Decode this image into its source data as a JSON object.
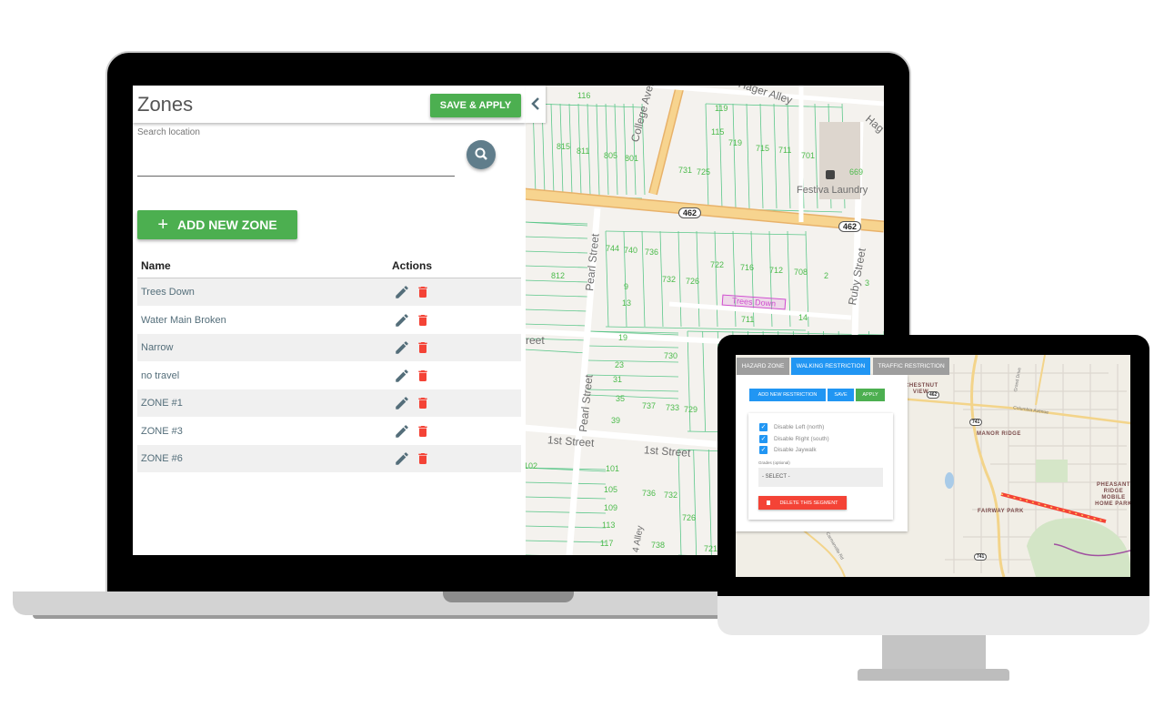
{
  "laptop": {
    "panel": {
      "title": "Zones",
      "save_apply_label": "SAVE & APPLY",
      "search": {
        "label": "Search location",
        "value": ""
      },
      "add_zone_label": "ADD NEW ZONE",
      "table": {
        "headers": [
          "Name",
          "Actions"
        ],
        "rows": [
          {
            "name": "Trees Down"
          },
          {
            "name": "Water Main Broken"
          },
          {
            "name": "Narrow"
          },
          {
            "name": "no travel"
          },
          {
            "name": "ZONE #1"
          },
          {
            "name": "ZONE #3"
          },
          {
            "name": "ZONE #6"
          }
        ]
      }
    },
    "map": {
      "streets": [
        "College Avenue",
        "Pearl Street",
        "Ruby Street",
        "1st Street",
        "Hager Alley",
        "Pearl Street",
        "1st Street",
        "Pearl Street",
        "reet",
        "Hag",
        "4 Alley"
      ],
      "route_shields": [
        "462",
        "462",
        "62"
      ],
      "poi": "Festiva Laundry",
      "zone_label": "Trees Down",
      "parcels": [
        "116",
        "119",
        "115",
        "815",
        "811",
        "805",
        "801",
        "719",
        "715",
        "711",
        "701",
        "731",
        "725",
        "669",
        "744",
        "740",
        "736",
        "722",
        "716",
        "712",
        "708",
        "2",
        "812",
        "732",
        "726",
        "9",
        "13",
        "711",
        "14",
        "3",
        "19",
        "23",
        "730",
        "31",
        "35",
        "39",
        "737",
        "733",
        "729",
        "101",
        "105",
        "109",
        "113",
        "117",
        "736",
        "732",
        "726",
        "738",
        "721",
        "102"
      ]
    },
    "colors": {
      "primary_green": "#4caf50",
      "delete_red": "#f44336",
      "search_button": "#607d8b",
      "zone_highlight": "#d04bd0"
    }
  },
  "monitor": {
    "tabs": [
      {
        "label": "HAZARD ZONE",
        "active": false
      },
      {
        "label": "WALKING RESTRICTION",
        "active": true
      },
      {
        "label": "TRAFFIC RESTRICTION",
        "active": false
      }
    ],
    "buttons": {
      "add_restriction": "ADD NEW RESTRICTION",
      "save": "SAVE",
      "apply": "APPLY"
    },
    "checkboxes": [
      {
        "label": "Disable Left (north)",
        "checked": true
      },
      {
        "label": "Disable Right (south)",
        "checked": true
      },
      {
        "label": "Disable Jaywalk",
        "checked": true
      }
    ],
    "grades_label": "Grades (optional)",
    "grades_select": "- SELECT -",
    "delete_segment_label": "DELETE THIS SEGMENT",
    "map": {
      "places": [
        "CHESTNUT VIEW",
        "MANOR RIDGE",
        "FAIRWAY PARK",
        "PHEASANT RIDGE MOBILE HOME PARK"
      ],
      "roads": [
        "Columbia Avenue",
        "Grand Drive",
        "S Carmanville Rd"
      ],
      "shields": [
        "462",
        "741",
        "741"
      ]
    },
    "colors": {
      "active_tab": "#2196f3",
      "inactive_tab": "#9e9e9e",
      "apply": "#4caf50",
      "delete": "#f44336",
      "segment": "#f44336"
    }
  }
}
